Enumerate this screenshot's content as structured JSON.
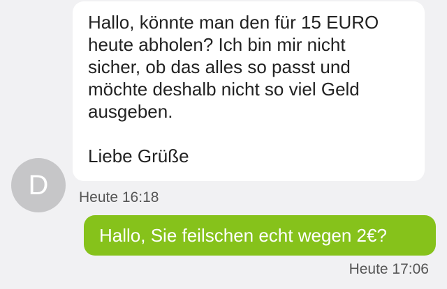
{
  "conversation": {
    "incoming": {
      "avatar_initial": "D",
      "lines": [
        "Hallo, könnte man den für 15 EURO",
        "heute abholen? Ich bin mir nicht",
        "sicher, ob das alles so passt und",
        "möchte deshalb nicht so viel Geld",
        "ausgeben.",
        "",
        "Liebe Grüße"
      ],
      "timestamp": "Heute 16:18"
    },
    "outgoing": {
      "text": "Hallo, Sie feilschen echt wegen 2€?",
      "timestamp": "Heute 17:06"
    }
  },
  "colors": {
    "background": "#f1f1f3",
    "incoming_bubble": "#ffffff",
    "outgoing_bubble": "#86c21b",
    "avatar": "#c6c6c8"
  }
}
